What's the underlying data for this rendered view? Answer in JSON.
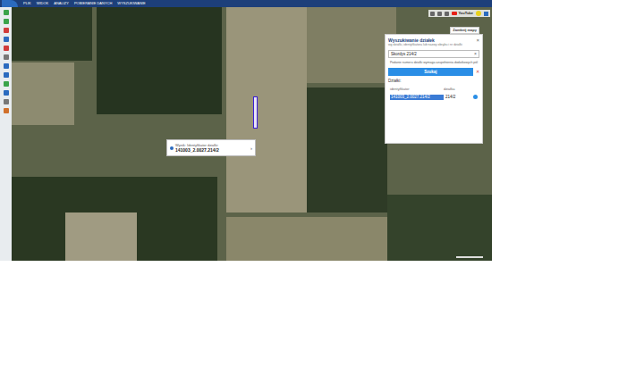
{
  "top_menu": [
    {
      "label": "PLIK"
    },
    {
      "label": "WIDOK"
    },
    {
      "label": "ANALIZY"
    },
    {
      "label": "POBIERANIE DANYCH"
    },
    {
      "label": "WYSZUKIWANIE"
    }
  ],
  "top_right": {
    "youtube": "YouTube",
    "close_maps": "Zamknij mapy"
  },
  "popup": {
    "line1": "Wynik: Identyfikator działki:",
    "line2": "141003_2.0027.214/2",
    "more": "›"
  },
  "search_panel": {
    "title": "Wyszukiwanie działek",
    "subtitle": "wg działki, identyfikatora lub nazwy obrębu i nr działki",
    "close": "×",
    "query": "Skordys 214/2",
    "clear_query": "×",
    "hint": "Podanie numeru działki wymaga uzupełnienia dodatkowych pól",
    "button": "Szukaj",
    "clear": "✕",
    "results_label": "Działki:",
    "columns": [
      "identyfikator",
      "działka"
    ],
    "rows": [
      {
        "identyfikator": "141003_2.0027.214/2",
        "dzialka": "214/2",
        "selected": true
      }
    ]
  }
}
